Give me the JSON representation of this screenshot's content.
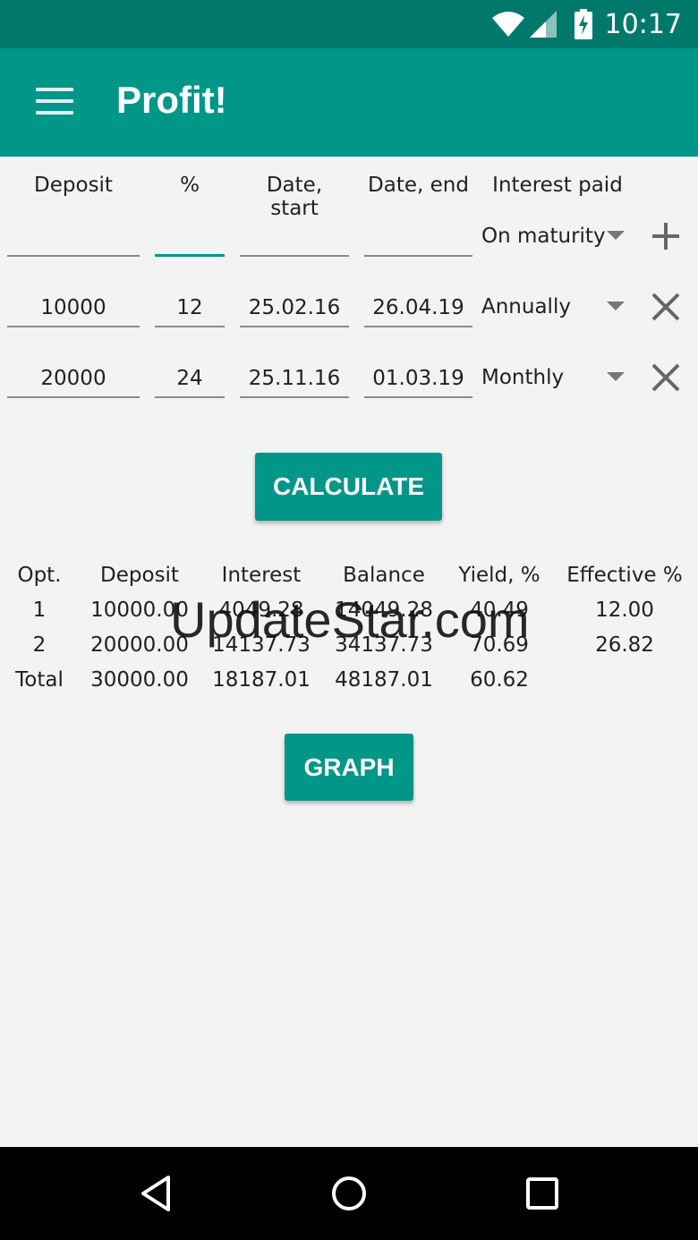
{
  "status": {
    "time": "10:17",
    "icons": [
      "wifi-icon",
      "signal-icon",
      "battery-charging-icon"
    ]
  },
  "appbar": {
    "title": "Profit!",
    "menu_icon": "menu-icon"
  },
  "inputs": {
    "headers": [
      "Deposit",
      "%",
      "Date, start",
      "Date, end",
      "Interest paid"
    ],
    "new_row": {
      "deposit": "",
      "percent": "",
      "date_start": "",
      "date_end": "",
      "interest_paid": "On maturity",
      "action_icon": "add-icon"
    },
    "rows": [
      {
        "deposit": "10000",
        "percent": "12",
        "date_start": "25.02.16",
        "date_end": "26.04.19",
        "interest_paid": "Annually",
        "action_icon": "close-icon"
      },
      {
        "deposit": "20000",
        "percent": "24",
        "date_start": "25.11.16",
        "date_end": "01.03.19",
        "interest_paid": "Monthly",
        "action_icon": "close-icon"
      }
    ]
  },
  "buttons": {
    "calculate": "CALCULATE",
    "graph": "GRAPH"
  },
  "results": {
    "headers": [
      "Opt.",
      "Deposit",
      "Interest",
      "Balance",
      "Yield, %",
      "Effective %"
    ],
    "rows": [
      [
        "1",
        "10000.00",
        "4049.28",
        "14049.28",
        "40.49",
        "12.00"
      ],
      [
        "2",
        "20000.00",
        "14137.73",
        "34137.73",
        "70.69",
        "26.82"
      ],
      [
        "Total",
        "30000.00",
        "18187.01",
        "48187.01",
        "60.62",
        ""
      ]
    ]
  },
  "watermark": "UpdateStar.com",
  "colors": {
    "primary": "#009688",
    "primary_dark": "#00796b",
    "background": "#f3f3f3"
  },
  "navbar": {
    "icons": [
      "back-icon",
      "home-icon",
      "recents-icon"
    ]
  }
}
